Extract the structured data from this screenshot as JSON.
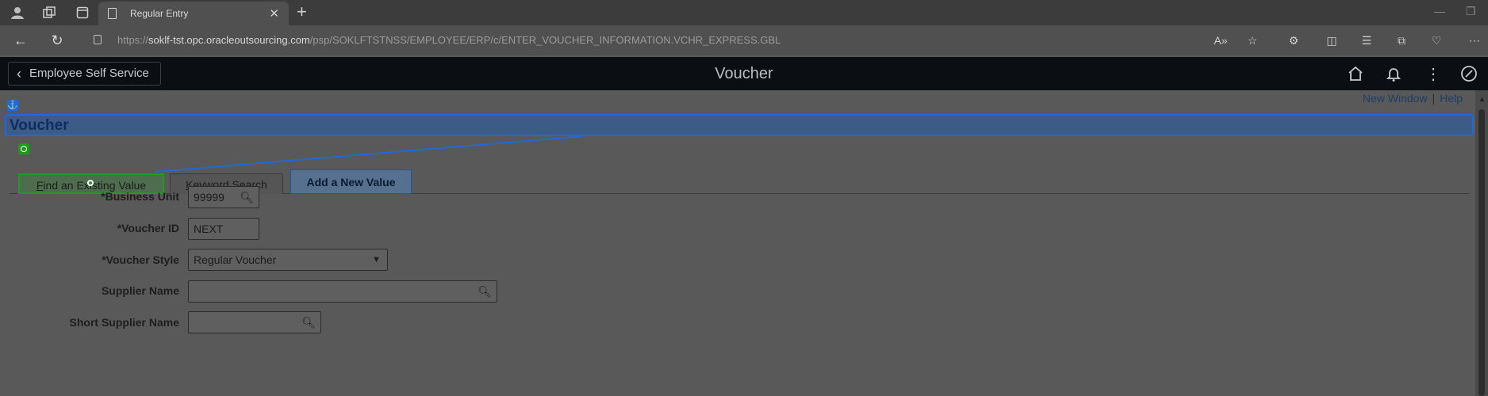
{
  "browser": {
    "tab_title": "Regular Entry",
    "url_prefix": "https://",
    "url_host": "soklf-tst.opc.oracleoutsourcing.com",
    "url_path": "/psp/SOKLFTSTNSS/EMPLOYEE/ERP/c/ENTER_VOUCHER_INFORMATION.VCHR_EXPRESS.GBL"
  },
  "header": {
    "back_label": "Employee Self Service",
    "title": "Voucher"
  },
  "toplinks": {
    "new_window": "New Window",
    "separator": "|",
    "help": "Help"
  },
  "page": {
    "title": "Voucher"
  },
  "tabs": [
    {
      "label_prefix": "",
      "underline": "F",
      "label_rest": "ind an Existing Value"
    },
    {
      "label_prefix": "",
      "underline": "K",
      "label_rest": "eyword Search"
    },
    {
      "label": "Add a New Value"
    }
  ],
  "form": {
    "business_unit_label": "*Business Unit",
    "business_unit_value": "99999",
    "voucher_id_label": "*Voucher ID",
    "voucher_id_value": "NEXT",
    "voucher_style_label": "*Voucher Style",
    "voucher_style_value": "Regular Voucher",
    "supplier_name_label": "Supplier Name",
    "supplier_name_value": "",
    "short_supplier_name_label": "Short Supplier Name",
    "short_supplier_name_value": ""
  },
  "colors": {
    "header_bg": "#0b0f14",
    "highlight_blue": "#1f6ad6",
    "highlight_green": "#1f9b1f",
    "active_tab": "#55718f"
  }
}
